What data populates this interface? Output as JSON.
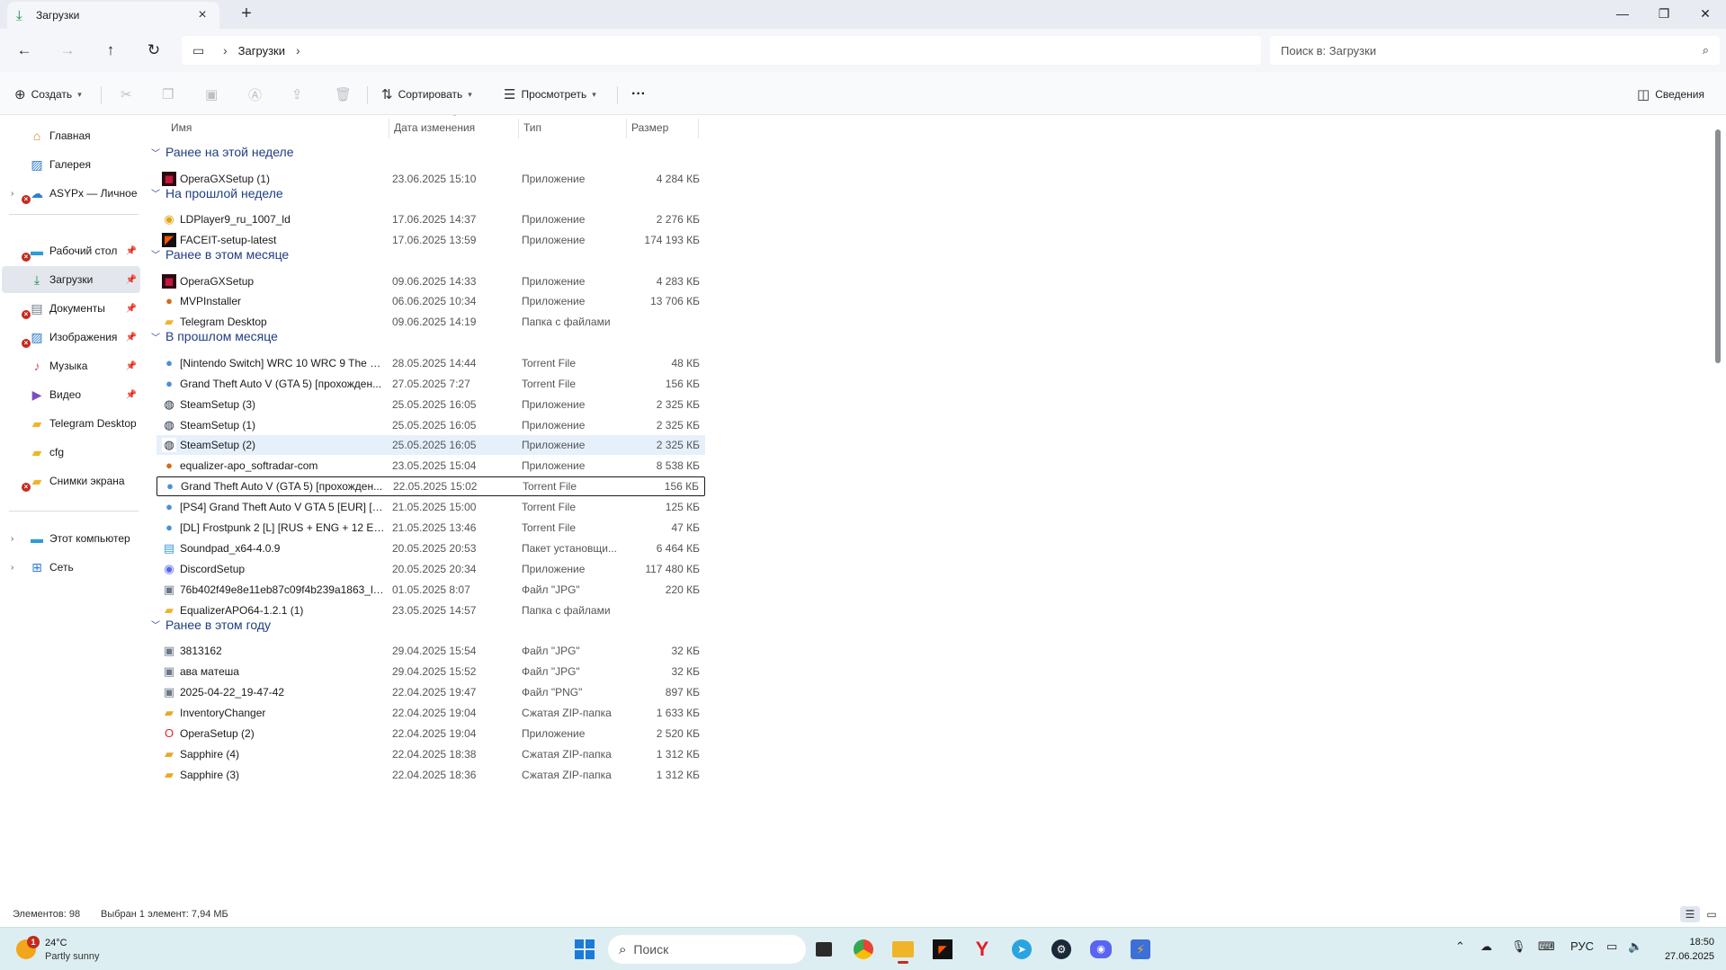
{
  "window": {
    "tab_title": "Загрузки",
    "new_tab": "+",
    "controls": {
      "minimize": "—",
      "maximize": "❐",
      "close": "✕"
    }
  },
  "address": {
    "breadcrumb": [
      "Загрузки"
    ],
    "search_placeholder": "Поиск в: Загрузки"
  },
  "commands": {
    "create": "Создать",
    "sort": "Сортировать",
    "view": "Просмотреть",
    "more": "···",
    "details": "Сведения"
  },
  "sidebar": {
    "items": [
      {
        "label": "Главная",
        "icon": "home-icon"
      },
      {
        "label": "Галерея",
        "icon": "gallery-icon"
      },
      {
        "label": "ASYPx — Личное",
        "icon": "cloud-icon"
      },
      {
        "label": "Рабочий стол",
        "icon": "desktop-icon"
      },
      {
        "label": "Загрузки",
        "icon": "download-icon"
      },
      {
        "label": "Документы",
        "icon": "documents-icon"
      },
      {
        "label": "Изображения",
        "icon": "pictures-icon"
      },
      {
        "label": "Музыка",
        "icon": "music-icon"
      },
      {
        "label": "Видео",
        "icon": "video-icon"
      },
      {
        "label": "Telegram Desktop",
        "icon": "folder-icon"
      },
      {
        "label": "cfg",
        "icon": "folder-icon"
      },
      {
        "label": "Снимки экрана",
        "icon": "folder-icon"
      },
      {
        "label": "Этот компьютер",
        "icon": "computer-icon"
      },
      {
        "label": "Сеть",
        "icon": "network-icon"
      }
    ]
  },
  "columns": {
    "name": "Имя",
    "date": "Дата изменения",
    "type": "Тип",
    "size": "Размер"
  },
  "groups": [
    {
      "label": "Ранее на этой неделе",
      "files": [
        {
          "name": "OperaGXSetup (1)",
          "date": "23.06.2025 15:10",
          "type": "Приложение",
          "size": "4 284 КБ",
          "icon": "opera-gx-icon"
        }
      ]
    },
    {
      "label": "На прошлой неделе",
      "files": [
        {
          "name": "LDPlayer9_ru_1007_ld",
          "date": "17.06.2025 14:37",
          "type": "Приложение",
          "size": "2 276 КБ",
          "icon": "ldplayer-icon"
        },
        {
          "name": "FACEIT-setup-latest",
          "date": "17.06.2025 13:59",
          "type": "Приложение",
          "size": "174 193 КБ",
          "icon": "faceit-icon"
        }
      ]
    },
    {
      "label": "Ранее в этом месяце",
      "files": [
        {
          "name": "OperaGXSetup",
          "date": "09.06.2025 14:33",
          "type": "Приложение",
          "size": "4 283 КБ",
          "icon": "opera-gx-icon"
        },
        {
          "name": "MVPInstaller",
          "date": "06.06.2025 10:34",
          "type": "Приложение",
          "size": "13 706 КБ",
          "icon": "installer-icon"
        },
        {
          "name": "Telegram Desktop",
          "date": "09.06.2025 14:19",
          "type": "Папка с файлами",
          "size": "",
          "icon": "folder-icon"
        }
      ]
    },
    {
      "label": "В прошлом месяце",
      "files": [
        {
          "name": "[Nintendo Switch] WRC 10 WRC 9 The Of...",
          "date": "28.05.2025 14:44",
          "type": "Torrent File",
          "size": "48 КБ",
          "icon": "torrent-icon"
        },
        {
          "name": "Grand Theft Auto V (GTA 5) [прохожден...",
          "date": "27.05.2025 7:27",
          "type": "Torrent File",
          "size": "156 КБ",
          "icon": "torrent-icon"
        },
        {
          "name": "SteamSetup (3)",
          "date": "25.05.2025 16:05",
          "type": "Приложение",
          "size": "2 325 КБ",
          "icon": "steam-icon"
        },
        {
          "name": "SteamSetup (1)",
          "date": "25.05.2025 16:05",
          "type": "Приложение",
          "size": "2 325 КБ",
          "icon": "steam-icon"
        },
        {
          "name": "SteamSetup (2)",
          "date": "25.05.2025 16:05",
          "type": "Приложение",
          "size": "2 325 КБ",
          "icon": "steam-icon"
        },
        {
          "name": "equalizer-apo_softradar-com",
          "date": "23.05.2025 15:04",
          "type": "Приложение",
          "size": "8 538 КБ",
          "icon": "installer-icon"
        },
        {
          "name": "Grand Theft Auto V (GTA 5) [прохожден...",
          "date": "22.05.2025 15:02",
          "type": "Torrent File",
          "size": "156 КБ",
          "icon": "torrent-icon"
        },
        {
          "name": "[PS4] Grand Theft Auto V GTA 5 [EUR] [M...",
          "date": "21.05.2025 15:00",
          "type": "Torrent File",
          "size": "125 КБ",
          "icon": "torrent-icon"
        },
        {
          "name": "[DL] Frostpunk 2 [L] [RUS + ENG + 12 EN...",
          "date": "21.05.2025 13:46",
          "type": "Torrent File",
          "size": "47 КБ",
          "icon": "torrent-icon"
        },
        {
          "name": "Soundpad_x64-4.0.9",
          "date": "20.05.2025 20:53",
          "type": "Пакет установщи...",
          "size": "6 464 КБ",
          "icon": "msi-icon"
        },
        {
          "name": "DiscordSetup",
          "date": "20.05.2025 20:34",
          "type": "Приложение",
          "size": "117 480 КБ",
          "icon": "discord-icon"
        },
        {
          "name": "76b402f49e8e11eb87c09f4b239a1863_large",
          "date": "01.05.2025 8:07",
          "type": "Файл \"JPG\"",
          "size": "220 КБ",
          "icon": "image-file-icon"
        },
        {
          "name": "EqualizerAPO64-1.2.1 (1)",
          "date": "23.05.2025 14:57",
          "type": "Папка с файлами",
          "size": "",
          "icon": "folder-icon"
        }
      ]
    },
    {
      "label": "Ранее в этом году",
      "files": [
        {
          "name": "3813162",
          "date": "29.04.2025 15:54",
          "type": "Файл \"JPG\"",
          "size": "32 КБ",
          "icon": "image-file-icon"
        },
        {
          "name": "ава матеша",
          "date": "29.04.2025 15:52",
          "type": "Файл \"JPG\"",
          "size": "32 КБ",
          "icon": "image-file-icon"
        },
        {
          "name": "2025-04-22_19-47-42",
          "date": "22.04.2025 19:47",
          "type": "Файл \"PNG\"",
          "size": "897 КБ",
          "icon": "image-file-icon"
        },
        {
          "name": "InventoryChanger",
          "date": "22.04.2025 19:04",
          "type": "Сжатая ZIP-папка",
          "size": "1 633 КБ",
          "icon": "zip-folder-icon"
        },
        {
          "name": "OperaSetup (2)",
          "date": "22.04.2025 19:04",
          "type": "Приложение",
          "size": "2 520 КБ",
          "icon": "opera-icon"
        },
        {
          "name": "Sapphire (4)",
          "date": "22.04.2025 18:38",
          "type": "Сжатая ZIP-папка",
          "size": "1 312 КБ",
          "icon": "zip-folder-icon"
        },
        {
          "name": "Sapphire (3)",
          "date": "22.04.2025 18:36",
          "type": "Сжатая ZIP-папка",
          "size": "1 312 КБ",
          "icon": "zip-folder-icon"
        }
      ]
    }
  ],
  "status": {
    "count": "Элементов: 98",
    "selection": "Выбран 1 элемент: 7,94 МБ"
  },
  "taskbar": {
    "weather_temp": "24°C",
    "weather_desc": "Partly sunny",
    "weather_badge": "1",
    "search_label": "Поиск",
    "lang": "РУС",
    "time": "18:50",
    "date": "27.06.2025"
  },
  "colors": {
    "accent": "#1f3e80",
    "selected_row": "#e5f0fb",
    "sidebar_selected": "#e3e7ed",
    "taskbar": "#ddeef2"
  }
}
